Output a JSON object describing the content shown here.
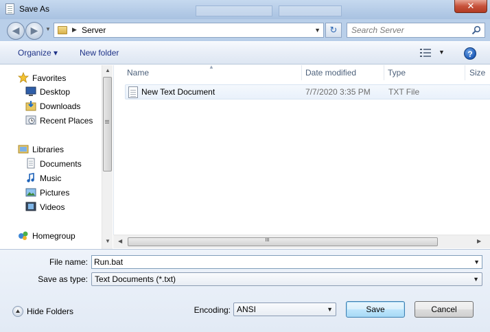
{
  "window": {
    "title": "Save As",
    "close_glyph": "✕"
  },
  "address": {
    "crumb": "Server",
    "search_placeholder": "Search Server"
  },
  "toolbar": {
    "organize_label": "Organize ▾",
    "new_folder_label": "New folder",
    "help_glyph": "?"
  },
  "nav": {
    "items": [
      {
        "label": "Favorites",
        "icon": "star-icon"
      },
      {
        "label": "Desktop",
        "icon": "desktop-icon"
      },
      {
        "label": "Downloads",
        "icon": "downloads-icon"
      },
      {
        "label": "Recent Places",
        "icon": "recent-places-icon"
      },
      {
        "label": "Libraries",
        "icon": "libraries-icon"
      },
      {
        "label": "Documents",
        "icon": "documents-icon"
      },
      {
        "label": "Music",
        "icon": "music-icon"
      },
      {
        "label": "Pictures",
        "icon": "pictures-icon"
      },
      {
        "label": "Videos",
        "icon": "videos-icon"
      },
      {
        "label": "Homegroup",
        "icon": "homegroup-icon"
      }
    ]
  },
  "files": {
    "columns": [
      "Name",
      "Date modified",
      "Type",
      "Size"
    ],
    "rows": [
      {
        "name": "New Text Document",
        "date": "7/7/2020 3:35 PM",
        "type": "TXT File"
      }
    ]
  },
  "form": {
    "file_name_label": "File name:",
    "file_name_value": "Run.bat",
    "save_type_label": "Save as type:",
    "save_type_value": "Text Documents (*.txt)",
    "encoding_label": "Encoding:",
    "encoding_value": "ANSI",
    "save_label": "Save",
    "cancel_label": "Cancel",
    "hide_folders_label": "Hide Folders"
  },
  "colors": {
    "accent": "#1e3287",
    "titlebar": "#b9cfe9",
    "close": "#c7523b"
  }
}
